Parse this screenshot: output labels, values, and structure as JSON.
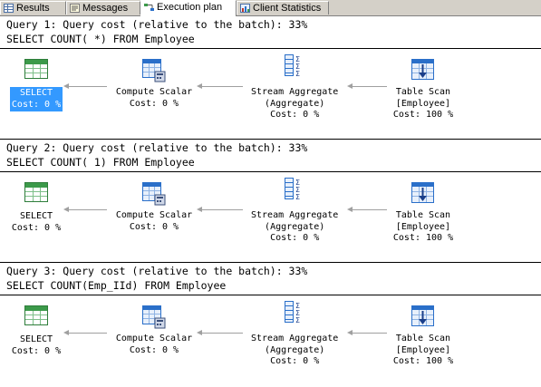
{
  "tabs": [
    {
      "label": "Results",
      "icon": "grid-icon"
    },
    {
      "label": "Messages",
      "icon": "messages-icon"
    },
    {
      "label": "Execution plan",
      "icon": "execution-plan-icon"
    },
    {
      "label": "Client Statistics",
      "icon": "client-statistics-icon"
    }
  ],
  "queries": [
    {
      "header": "Query 1: Query cost (relative to the batch): 33%",
      "sql": "SELECT COUNT( *) FROM Employee",
      "nodes": [
        {
          "name": "SELECT",
          "line2": "",
          "cost": "Cost: 0 %",
          "icon": "select-icon",
          "selected": true
        },
        {
          "name": "Compute Scalar",
          "line2": "",
          "cost": "Cost: 0 %",
          "icon": "compute-scalar-icon"
        },
        {
          "name": "Stream Aggregate",
          "line2": "(Aggregate)",
          "cost": "Cost: 0 %",
          "icon": "stream-aggregate-icon"
        },
        {
          "name": "Table Scan",
          "line2": "[Employee]",
          "cost": "Cost: 100 %",
          "icon": "table-scan-icon"
        }
      ]
    },
    {
      "header": "Query 2: Query cost (relative to the batch): 33%",
      "sql": "SELECT COUNT( 1) FROM Employee",
      "nodes": [
        {
          "name": "SELECT",
          "line2": "",
          "cost": "Cost: 0 %",
          "icon": "select-icon"
        },
        {
          "name": "Compute Scalar",
          "line2": "",
          "cost": "Cost: 0 %",
          "icon": "compute-scalar-icon"
        },
        {
          "name": "Stream Aggregate",
          "line2": "(Aggregate)",
          "cost": "Cost: 0 %",
          "icon": "stream-aggregate-icon"
        },
        {
          "name": "Table Scan",
          "line2": "[Employee]",
          "cost": "Cost: 100 %",
          "icon": "table-scan-icon"
        }
      ]
    },
    {
      "header": "Query 3: Query cost (relative to the batch): 33%",
      "sql": "SELECT COUNT(Emp_IId) FROM Employee",
      "nodes": [
        {
          "name": "SELECT",
          "line2": "",
          "cost": "Cost: 0 %",
          "icon": "select-icon"
        },
        {
          "name": "Compute Scalar",
          "line2": "",
          "cost": "Cost: 0 %",
          "icon": "compute-scalar-icon"
        },
        {
          "name": "Stream Aggregate",
          "line2": "(Aggregate)",
          "cost": "Cost: 0 %",
          "icon": "stream-aggregate-icon"
        },
        {
          "name": "Table Scan",
          "line2": "[Employee]",
          "cost": "Cost: 100 %",
          "icon": "table-scan-icon"
        }
      ]
    }
  ],
  "colors": {
    "selection": "#3399ff",
    "arrow": "#a0a0a0",
    "icon_green": "#3c9a4a",
    "icon_blue": "#2a6fc9"
  }
}
